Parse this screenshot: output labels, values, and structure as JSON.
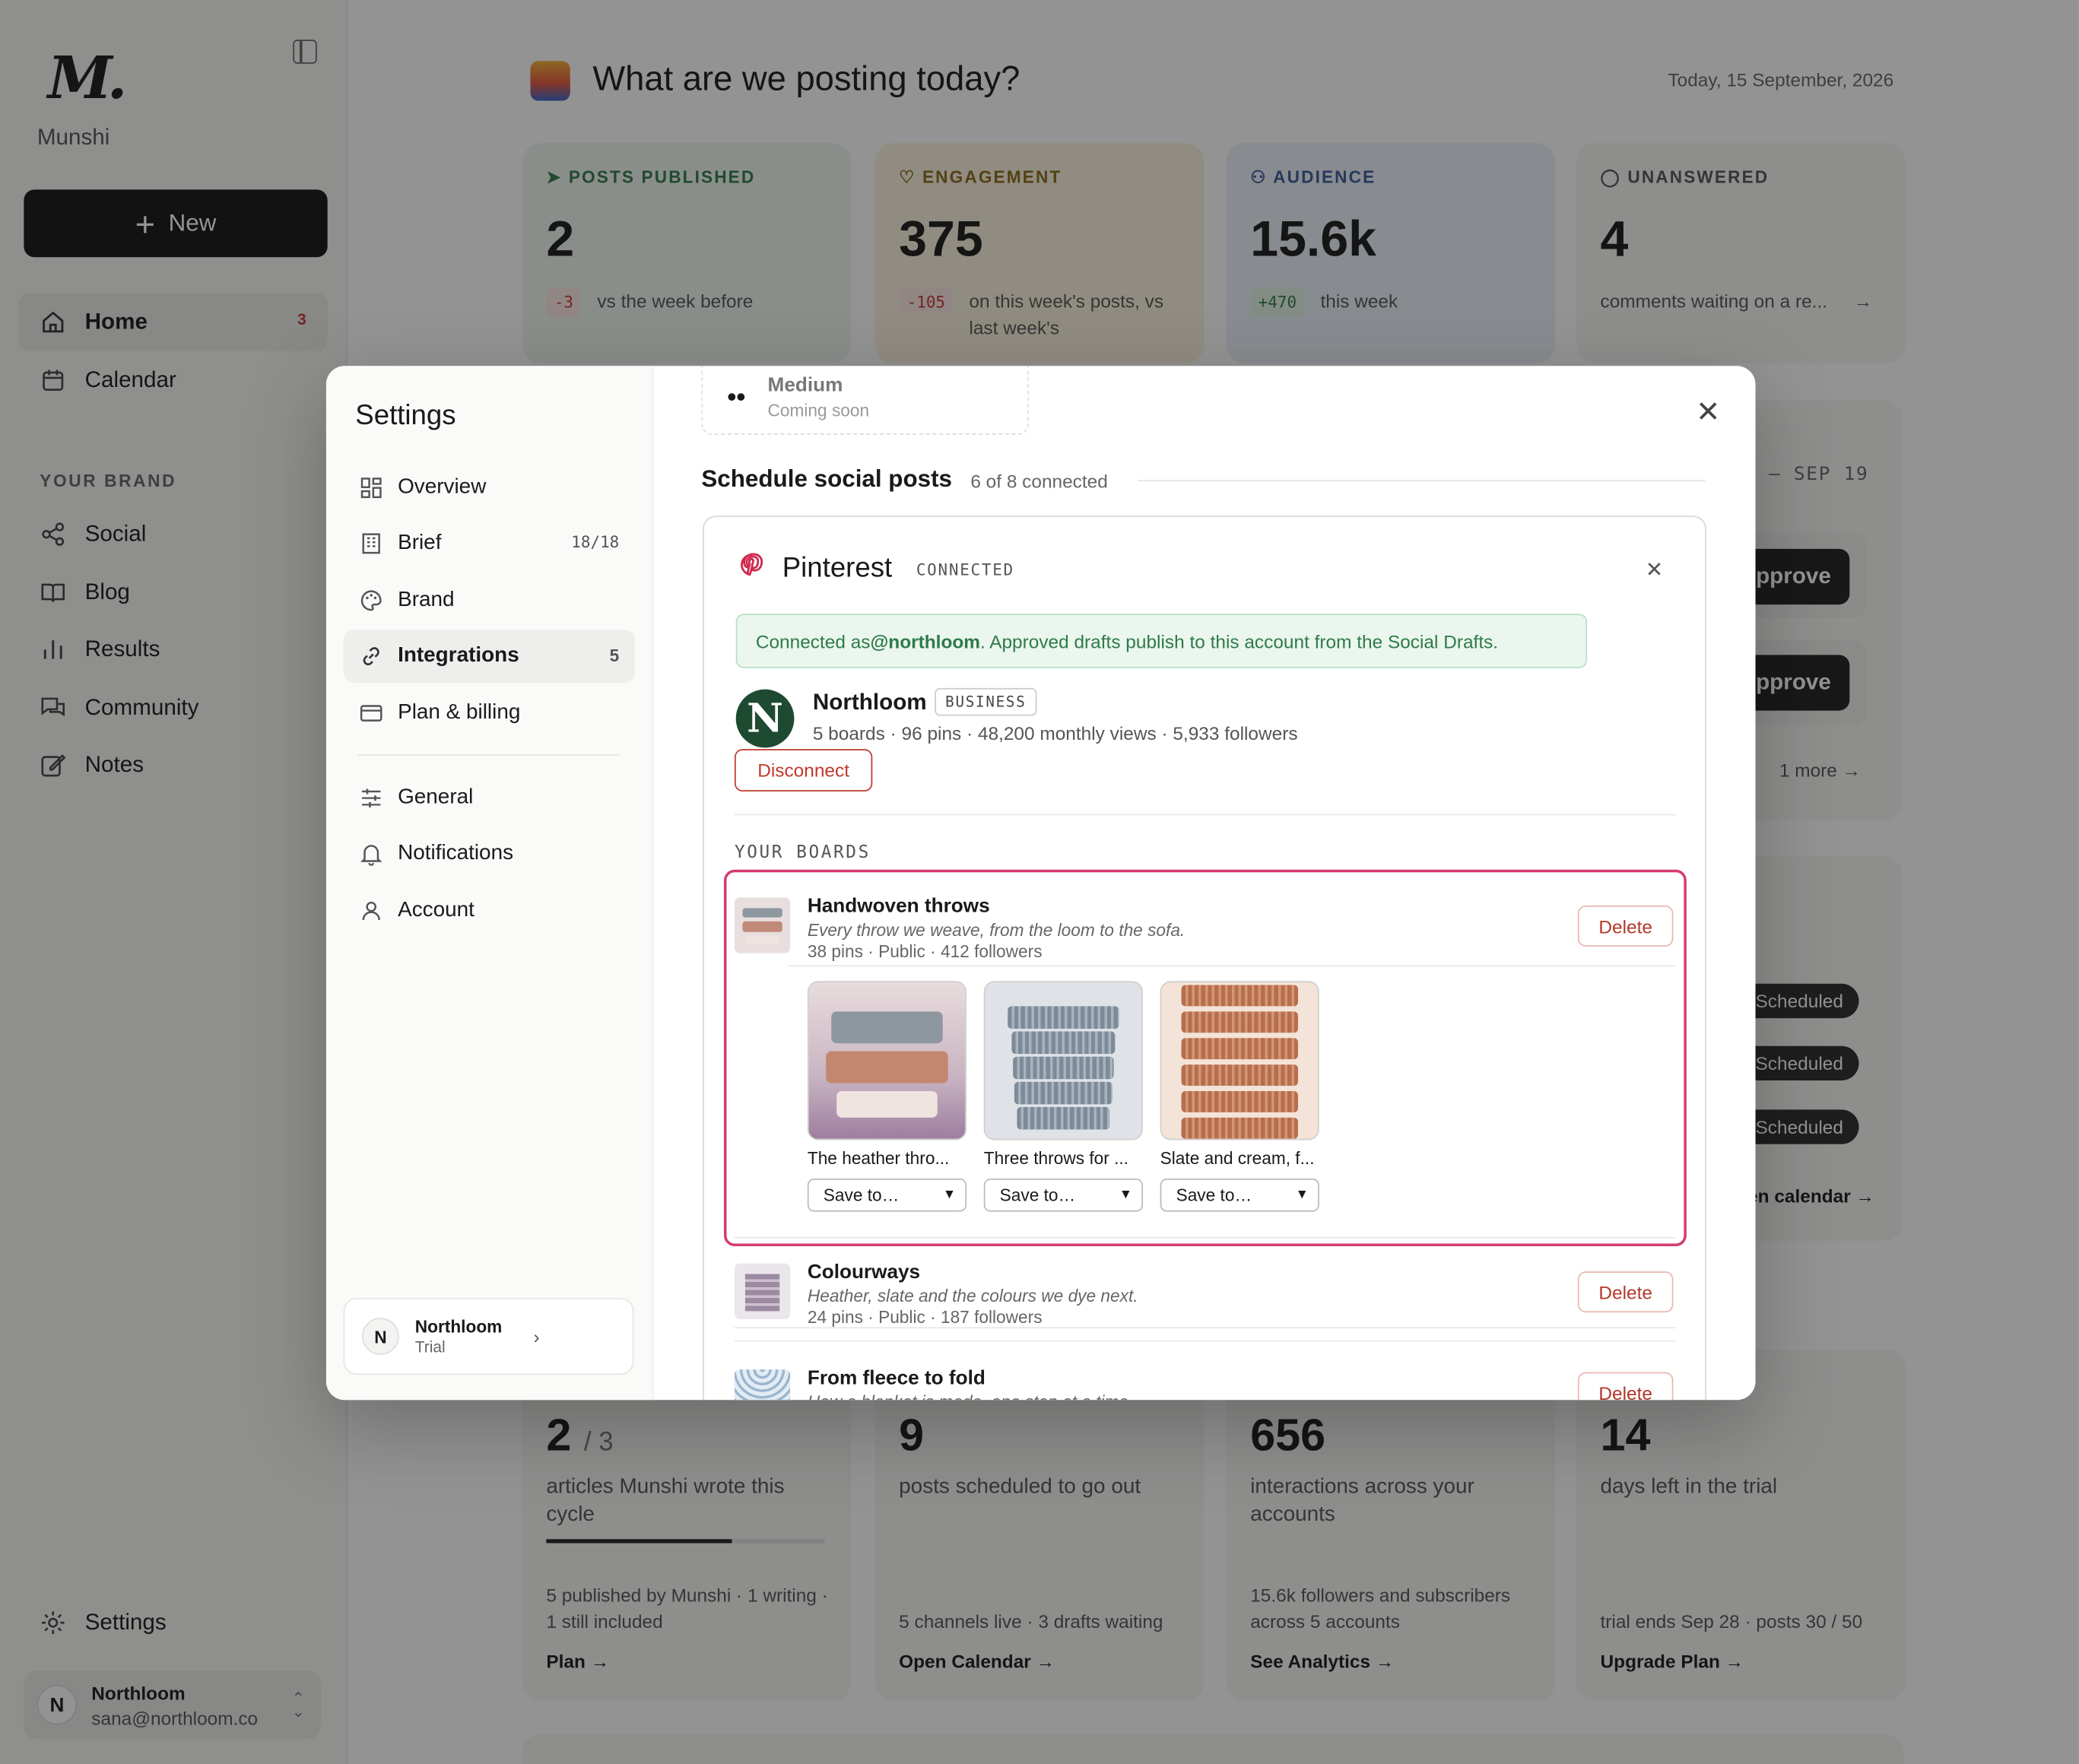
{
  "app": {
    "name": "Munshi",
    "new_label": "New",
    "collapse_icon": "sidebar-collapse-icon"
  },
  "sidebar": {
    "items": [
      {
        "label": "Home",
        "badge": "3",
        "icon": "home-icon"
      },
      {
        "label": "Calendar",
        "icon": "calendar-icon"
      }
    ],
    "section_label": "YOUR BRAND",
    "brand_items": [
      {
        "label": "Social",
        "icon": "share-icon"
      },
      {
        "label": "Blog",
        "icon": "book-icon"
      },
      {
        "label": "Results",
        "icon": "bar-chart-icon"
      },
      {
        "label": "Community",
        "icon": "chat-icon"
      },
      {
        "label": "Notes",
        "icon": "edit-icon"
      }
    ],
    "settings_label": "Settings",
    "user": {
      "initial": "N",
      "name": "Northloom",
      "email": "sana@northloom.co"
    }
  },
  "header": {
    "greeting": "What are we posting today?",
    "date": "Today, 15 September, 2026"
  },
  "stats": [
    {
      "label": "POSTS PUBLISHED",
      "value": "2",
      "chip": "-3",
      "sub": "vs the week before",
      "color": "#2f7a4a"
    },
    {
      "label": "ENGAGEMENT",
      "value": "375",
      "chip": "-105",
      "sub": "on this week's posts, vs last week's",
      "color": "#8a6a1a"
    },
    {
      "label": "AUDIENCE",
      "value": "15.6k",
      "chip": "+470",
      "sub": "this week",
      "color": "#3a5a9c"
    },
    {
      "label": "UNANSWERED",
      "value": "4",
      "sub": "comments waiting on a re...",
      "color": "#555555"
    }
  ],
  "right_panel": {
    "date_range": "– SEP 19",
    "approve_label": "pprove",
    "more_label": "1 more",
    "scheduled_label": "Scheduled",
    "calendar_link": "en calendar →"
  },
  "bottom_cards": [
    {
      "value": "2",
      "value_suffix": "/ 3",
      "desc": "articles Munshi wrote this cycle",
      "foot": "5 published by Munshi · 1 writing · 1 still included",
      "link": "Plan →",
      "progress": 0.667
    },
    {
      "value": "9",
      "desc": "posts scheduled to go out",
      "foot": "5 channels live · 3 drafts waiting",
      "link": "Open Calendar →"
    },
    {
      "value": "656",
      "desc": "interactions across your accounts",
      "foot": "15.6k followers and subscribers across 5 accounts",
      "link": "See Analytics →"
    },
    {
      "value": "14",
      "desc": "days left in the trial",
      "foot": "trial ends Sep 28 · posts 30 / 50",
      "link": "Upgrade Plan →"
    }
  ],
  "settings": {
    "title": "Settings",
    "nav": [
      {
        "label": "Overview",
        "icon": "grid-icon"
      },
      {
        "label": "Brief",
        "count": "18/18",
        "icon": "building-icon"
      },
      {
        "label": "Brand",
        "icon": "palette-icon"
      },
      {
        "label": "Integrations",
        "count": "5",
        "icon": "link-icon"
      },
      {
        "label": "Plan & billing",
        "icon": "card-icon"
      }
    ],
    "nav2": [
      {
        "label": "General",
        "icon": "sliders-icon"
      },
      {
        "label": "Notifications",
        "icon": "bell-icon"
      },
      {
        "label": "Account",
        "icon": "user-icon"
      }
    ],
    "account": {
      "initial": "N",
      "name": "Northloom",
      "plan": "Trial"
    }
  },
  "integrations": {
    "medium": {
      "name": "Medium",
      "status": "Coming soon"
    },
    "section_title": "Schedule social posts",
    "section_count": "6 of 8 connected",
    "pinterest": {
      "name": "Pinterest",
      "status": "CONNECTED",
      "banner_pre": "Connected as ",
      "banner_handle": "@northloom",
      "banner_post": ". Approved drafts publish to this account from the Social Drafts.",
      "account_initial": "N",
      "account_name": "Northloom",
      "account_type": "BUSINESS",
      "account_stats": "5 boards · 96 pins · 48,200 monthly views · 5,933 followers",
      "disconnect_label": "Disconnect",
      "boards_label": "YOUR BOARDS",
      "boards": [
        {
          "name": "Handwoven throws",
          "desc": "Every throw we weave, from the loom to the sofa.",
          "meta": "38 pins · Public · 412 followers",
          "delete_label": "Delete"
        },
        {
          "name": "Colourways",
          "desc": "Heather, slate and the colours we dye next.",
          "meta": "24 pins · Public · 187 followers",
          "delete_label": "Delete"
        },
        {
          "name": "From fleece to fold",
          "desc": "How a blanket is made, one step at a time.",
          "delete_label": "Delete"
        }
      ],
      "pins": [
        {
          "caption": "The heather thro...",
          "select": "Save to…"
        },
        {
          "caption": "Three throws for ...",
          "select": "Save to…"
        },
        {
          "caption": "Slate and cream, f...",
          "select": "Save to…"
        }
      ]
    }
  }
}
